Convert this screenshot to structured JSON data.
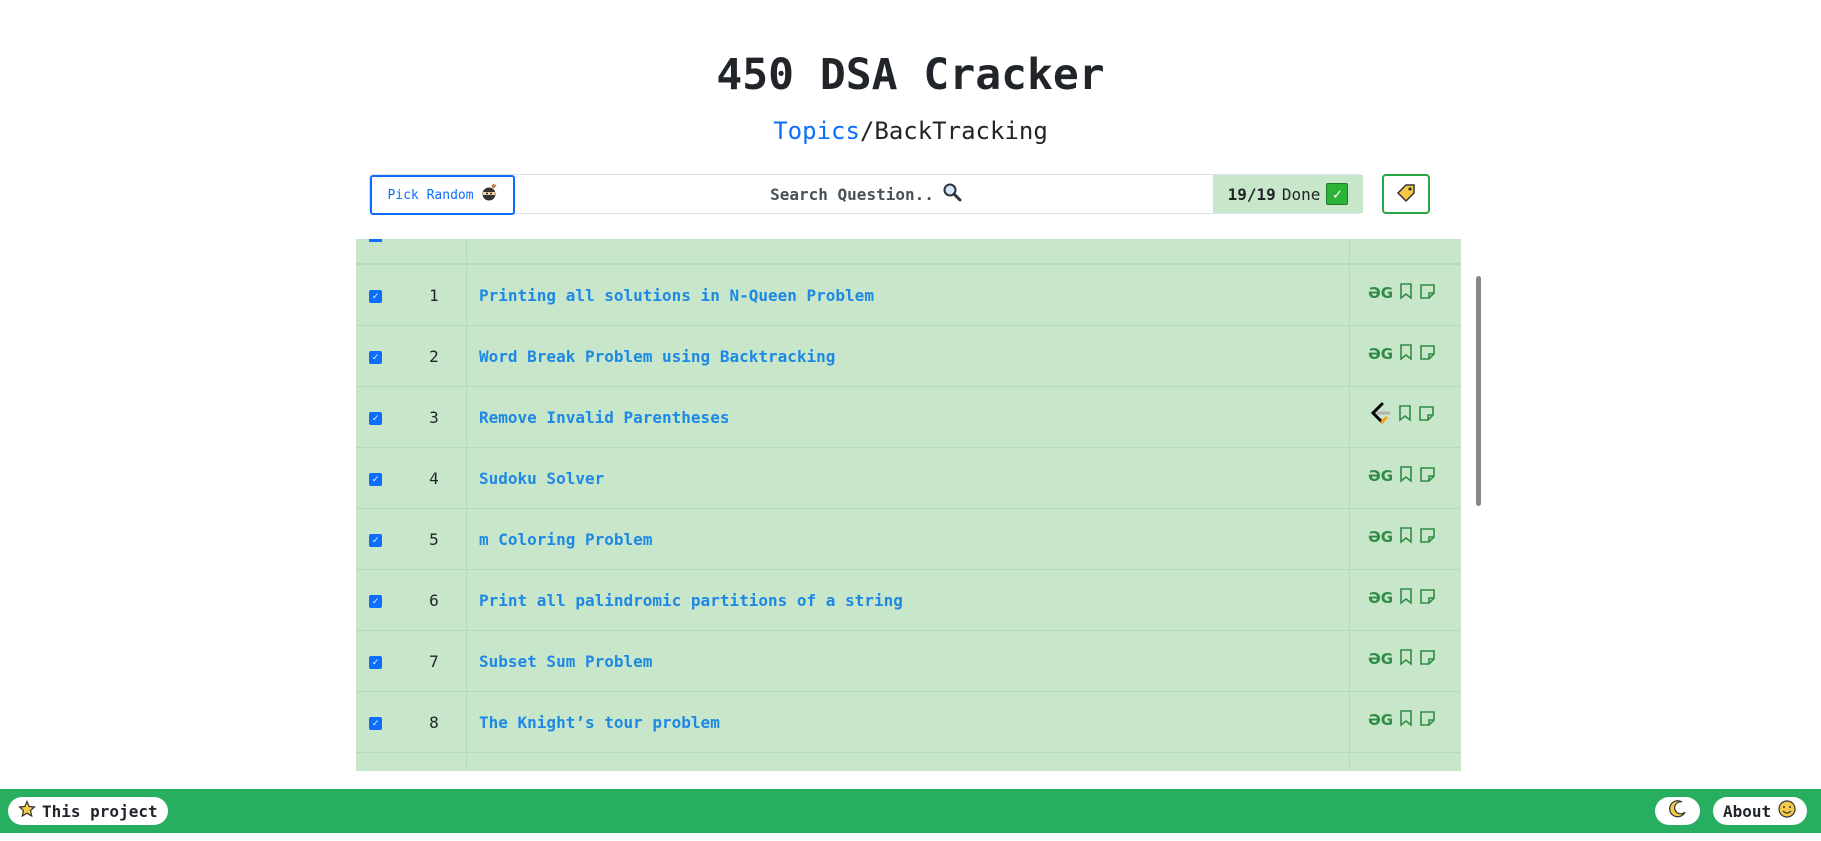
{
  "header": {
    "title": "450 DSA Cracker"
  },
  "breadcrumb": {
    "topics_label": "Topics",
    "separator": "/",
    "current": "BackTracking"
  },
  "toolbar": {
    "pick_random_label": "Pick Random",
    "search_placeholder": "Search Question..",
    "progress_done": "19/19",
    "progress_label": "Done"
  },
  "questions": [
    {
      "num": "1",
      "title": "Printing all solutions in N-Queen Problem",
      "source_icon": "gfg-icon"
    },
    {
      "num": "2",
      "title": "Word Break Problem using Backtracking",
      "source_icon": "gfg-icon"
    },
    {
      "num": "3",
      "title": "Remove Invalid Parentheses",
      "source_icon": "leetcode-icon"
    },
    {
      "num": "4",
      "title": "Sudoku Solver",
      "source_icon": "gfg-icon"
    },
    {
      "num": "5",
      "title": "m Coloring Problem",
      "source_icon": "gfg-icon"
    },
    {
      "num": "6",
      "title": "Print all palindromic partitions of a string",
      "source_icon": "gfg-icon"
    },
    {
      "num": "7",
      "title": "Subset Sum Problem",
      "source_icon": "gfg-icon"
    },
    {
      "num": "8",
      "title": "The Knight’s tour problem",
      "source_icon": "gfg-icon"
    }
  ],
  "footer": {
    "project_label": "This project",
    "about_label": "About"
  },
  "colors": {
    "row_bg": "#c8e6c9",
    "link": "#1e88e5",
    "footer_bg": "#27ae60",
    "gfg": "#2f8d46"
  }
}
